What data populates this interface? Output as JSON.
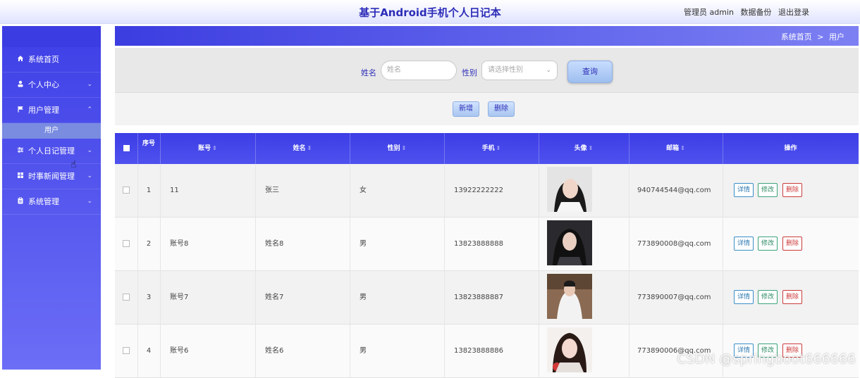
{
  "header": {
    "title": "基于Android手机个人日记本",
    "admin_label": "管理员 admin",
    "backup_label": "数据备份",
    "logout_label": "退出登录"
  },
  "sidebar": {
    "items": [
      {
        "label": "系统首页",
        "icon": "home-icon"
      },
      {
        "label": "个人中心",
        "icon": "user-icon"
      },
      {
        "label": "用户管理",
        "icon": "flag-icon"
      },
      {
        "label": "个人日记管理",
        "icon": "sliders-icon"
      },
      {
        "label": "时事新闻管理",
        "icon": "grid-icon"
      },
      {
        "label": "系统管理",
        "icon": "clipboard-icon"
      }
    ],
    "submenu_label": "用户"
  },
  "breadcrumb": {
    "home": "系统首页",
    "separator": ">",
    "current": "用户"
  },
  "search": {
    "name_label": "姓名",
    "name_placeholder": "姓名",
    "gender_label": "性别",
    "gender_placeholder": "请选择性别",
    "query_button": "查询"
  },
  "actions": {
    "add_button": "新增",
    "delete_button": "删除"
  },
  "table": {
    "columns": [
      "序号",
      "账号",
      "姓名",
      "性别",
      "手机",
      "头像",
      "邮箱",
      "操作"
    ],
    "rows": [
      {
        "index": "1",
        "account": "11",
        "name": "张三",
        "gender": "女",
        "phone": "13922222222",
        "email": "940744544@qq.com"
      },
      {
        "index": "2",
        "account": "账号8",
        "name": "姓名8",
        "gender": "男",
        "phone": "13823888888",
        "email": "773890008@qq.com"
      },
      {
        "index": "3",
        "account": "账号7",
        "name": "姓名7",
        "gender": "男",
        "phone": "13823888887",
        "email": "773890007@qq.com"
      },
      {
        "index": "4",
        "account": "账号6",
        "name": "姓名6",
        "gender": "男",
        "phone": "13823888886",
        "email": "773890006@qq.com"
      }
    ],
    "op_detail": "详情",
    "op_edit": "修改",
    "op_delete": "删除"
  },
  "watermark": "CSDN @springboot666666",
  "colors": {
    "primary": "#3c3de6",
    "title": "#2d2db8",
    "detail": "#2b78b2",
    "edit": "#2c8a63",
    "delete": "#cc3b3b"
  }
}
